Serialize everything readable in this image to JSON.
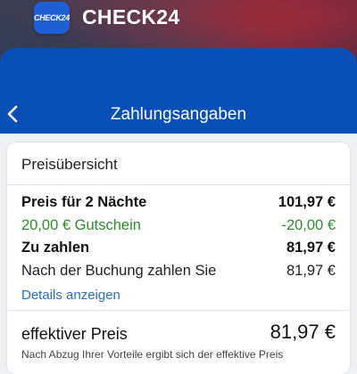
{
  "app": {
    "icon_text": "CHECK24",
    "name": "CHECK24",
    "brand_color": "#1f5fd6",
    "header_color": "#0a4fb8"
  },
  "nav": {
    "back_icon": "chevron-left-icon",
    "title": "Zahlungsangaben"
  },
  "price_overview": {
    "title": "Preisübersicht",
    "rows": [
      {
        "label": "Preis für 2 Nächte",
        "value": "101,97 €"
      },
      {
        "label": "20,00 € Gutschein",
        "value": "-20,00 €"
      },
      {
        "label": "Zu zahlen",
        "value": "81,97 €"
      },
      {
        "label": "Nach der Buchung zahlen Sie",
        "value": "81,97 €"
      }
    ],
    "details_link": "Details anzeigen",
    "effective": {
      "label": "effektiver Preis",
      "value": "81,97 €",
      "note": "Nach Abzug Ihrer Vorteile ergibt sich der effektive Preis"
    }
  },
  "colors": {
    "voucher": "#2e8b2e",
    "link": "#2b6fb8"
  }
}
